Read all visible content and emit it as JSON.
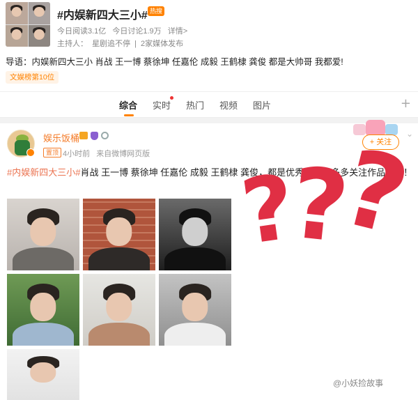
{
  "topic": {
    "title": "#内娱新四大三小#",
    "hot_badge": "热搜",
    "stats": {
      "reads": "今日阅读3.1亿",
      "discussions": "今日讨论1.9万",
      "details": "详情>"
    },
    "host": {
      "label": "主持人：",
      "name": "星剧追不停",
      "separator": "|",
      "media": "2家媒体发布"
    },
    "lead": "导语：内娱新四大三小 肖战 王一博 蔡徐坤 任嘉伦 成毅 王鹤棣 龚俊 都是大帅哥 我都爱!",
    "rank_tag": "文娱榜第10位"
  },
  "tabs": {
    "items": [
      "综合",
      "实时",
      "热门",
      "视频",
      "图片"
    ],
    "active_index": 0,
    "plus": "+"
  },
  "post": {
    "author": "娱乐饭桶",
    "top_tag": "置顶",
    "time": "4小时前",
    "source": "来自微博网页版",
    "follow_label": "+ 关注",
    "chevron": "⌄",
    "hashtag": "#内娱新四大三小#",
    "text": "肖战 王一博 蔡徐坤 任嘉伦 成毅 王鹤棣 龚俊，都是优秀的人，多多关注作品吧！！",
    "photo_count": 7
  },
  "overlay": {
    "marks": [
      "?",
      "?",
      "?"
    ],
    "color": "#e02f44"
  },
  "watermark": "@小妖捡故事",
  "colors": {
    "accent": "#ff8200",
    "author": "#f47b28",
    "hashtag": "#eb7350"
  }
}
